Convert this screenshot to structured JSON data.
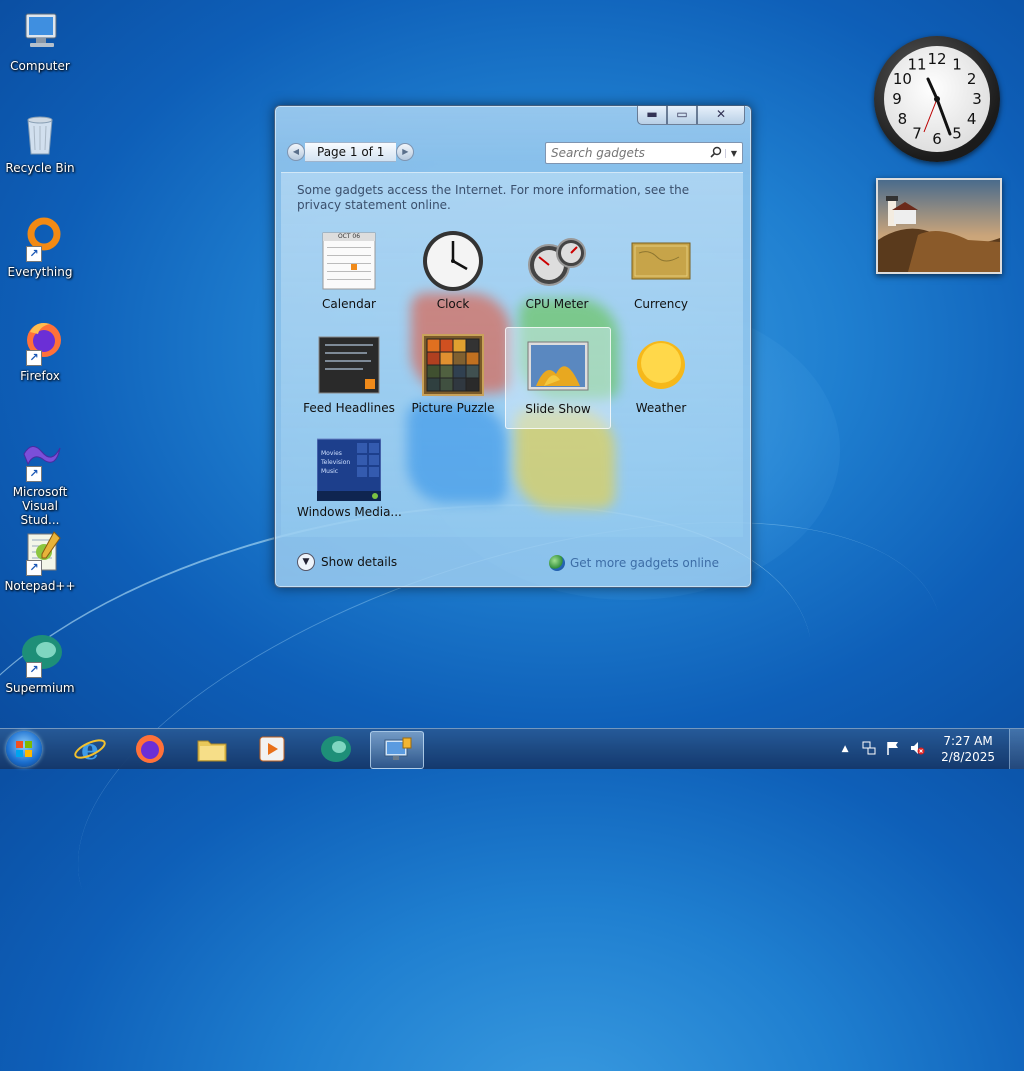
{
  "desktop": {
    "icons": [
      {
        "label": "Computer",
        "icon": "computer-icon"
      },
      {
        "label": "Recycle Bin",
        "icon": "recycle-bin-icon"
      },
      {
        "label": "Everything",
        "icon": "everything-icon"
      },
      {
        "label": "Firefox",
        "icon": "firefox-icon"
      },
      {
        "label": "Microsoft Visual Stud...",
        "icon": "visual-studio-icon"
      },
      {
        "label": "Notepad++",
        "icon": "notepad-plus-plus-icon"
      },
      {
        "label": "Supermium",
        "icon": "supermium-icon"
      }
    ],
    "shortcut_arrow": "↗"
  },
  "desktop_gadgets": {
    "clock": {
      "numbers": [
        "12",
        "1",
        "2",
        "3",
        "4",
        "5",
        "6",
        "7",
        "8",
        "9",
        "10",
        "11"
      ]
    },
    "slideshow": {
      "icon": "lighthouse-photo-icon"
    }
  },
  "gallery": {
    "window_buttons": {
      "minimize": "▬",
      "maximize": "▭",
      "close": "✕"
    },
    "pager": {
      "label": "Page 1 of 1",
      "prev": "◀",
      "next": "▶"
    },
    "search": {
      "placeholder": "Search gadgets",
      "icon": "search-icon"
    },
    "notice": "Some gadgets access the Internet.  For more information, see the privacy statement online.",
    "gadgets": [
      {
        "label": "Calendar",
        "icon": "calendar-gadget-icon",
        "month": "OCT 06"
      },
      {
        "label": "Clock",
        "icon": "clock-gadget-icon"
      },
      {
        "label": "CPU Meter",
        "icon": "cpu-meter-gadget-icon"
      },
      {
        "label": "Currency",
        "icon": "currency-gadget-icon"
      },
      {
        "label": "Feed Headlines",
        "icon": "feed-headlines-gadget-icon"
      },
      {
        "label": "Picture Puzzle",
        "icon": "picture-puzzle-gadget-icon"
      },
      {
        "label": "Slide Show",
        "icon": "slide-show-gadget-icon",
        "selected": true
      },
      {
        "label": "Weather",
        "icon": "weather-gadget-icon"
      },
      {
        "label": "Windows Media...",
        "icon": "windows-media-center-gadget-icon",
        "menu": [
          "Movies",
          "Television",
          "Music"
        ]
      }
    ],
    "footer": {
      "show_details": "Show details",
      "more_gadgets": "Get more gadgets online"
    }
  },
  "taskbar": {
    "items": [
      {
        "name": "internet-explorer",
        "icon": "internet-explorer-icon"
      },
      {
        "name": "firefox",
        "icon": "firefox-icon"
      },
      {
        "name": "file-explorer",
        "icon": "folder-icon"
      },
      {
        "name": "media-player",
        "icon": "media-player-icon"
      },
      {
        "name": "supermium",
        "icon": "supermium-icon"
      },
      {
        "name": "gadgets",
        "icon": "gadgets-icon",
        "active": true
      }
    ],
    "tray": {
      "overflow": "▲",
      "time": "7:27 AM",
      "date": "2/8/2025"
    }
  },
  "colors": {
    "desktop_blue": "#1f7fd0",
    "window_glass": "#a6d0f0",
    "link_blue": "#3d6da6"
  }
}
